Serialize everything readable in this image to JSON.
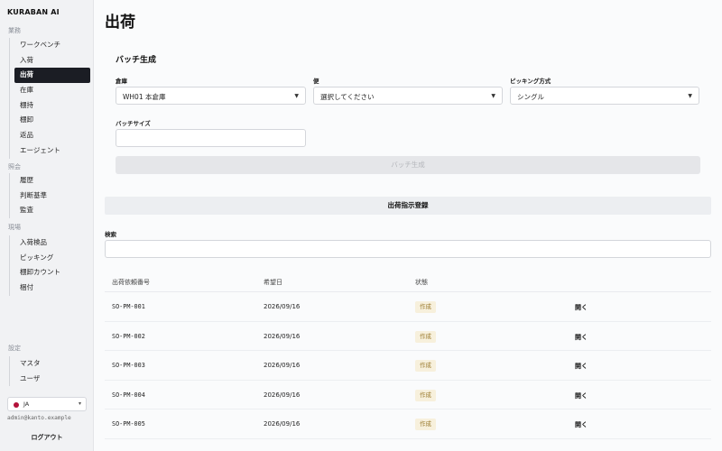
{
  "app": {
    "brand": "KURABAN AI"
  },
  "sidebar": {
    "sections": [
      {
        "label": "業務",
        "items": [
          "ワークベンチ",
          "入荷",
          "出荷",
          "在庫",
          "棚持",
          "棚卸",
          "返品",
          "エージェント"
        ]
      },
      {
        "label": "照会",
        "items": [
          "履歴",
          "判断基準",
          "監査"
        ]
      },
      {
        "label": "現場",
        "items": [
          "入荷検品",
          "ピッキング",
          "棚卸カウント",
          "梱付"
        ]
      },
      {
        "label": "設定",
        "items": [
          "マスタ",
          "ユーザ"
        ]
      }
    ],
    "active_item": "出荷",
    "language": "JA",
    "user_email": "admin@kanto.example",
    "logout_label": "ログアウト"
  },
  "page": {
    "title": "出荷"
  },
  "batch": {
    "title": "バッチ生成",
    "warehouse_label": "倉庫",
    "warehouse_value": "WH01 本倉庫",
    "flight_label": "便",
    "flight_value": "選択してください",
    "picking_label": "ピッキング方式",
    "picking_value": "シングル",
    "size_label": "バッチサイズ",
    "size_value": "",
    "generate_button": "バッチ生成"
  },
  "register_button": "出荷指示登録",
  "search": {
    "label": "検索",
    "value": ""
  },
  "table": {
    "headers": [
      "出荷依頼番号",
      "希望日",
      "状態",
      ""
    ],
    "rows": [
      {
        "id": "SO-PM-001",
        "date": "2026/09/16",
        "status": "作成",
        "action": "開く"
      },
      {
        "id": "SO-PM-002",
        "date": "2026/09/16",
        "status": "作成",
        "action": "開く"
      },
      {
        "id": "SO-PM-003",
        "date": "2026/09/16",
        "status": "作成",
        "action": "開く"
      },
      {
        "id": "SO-PM-004",
        "date": "2026/09/16",
        "status": "作成",
        "action": "開く"
      },
      {
        "id": "SO-PM-005",
        "date": "2026/09/16",
        "status": "作成",
        "action": "開く"
      }
    ]
  },
  "colors": {
    "accent": "#1b1d24",
    "badge_bg": "#f7f0dc",
    "badge_text": "#9a7a2e"
  }
}
